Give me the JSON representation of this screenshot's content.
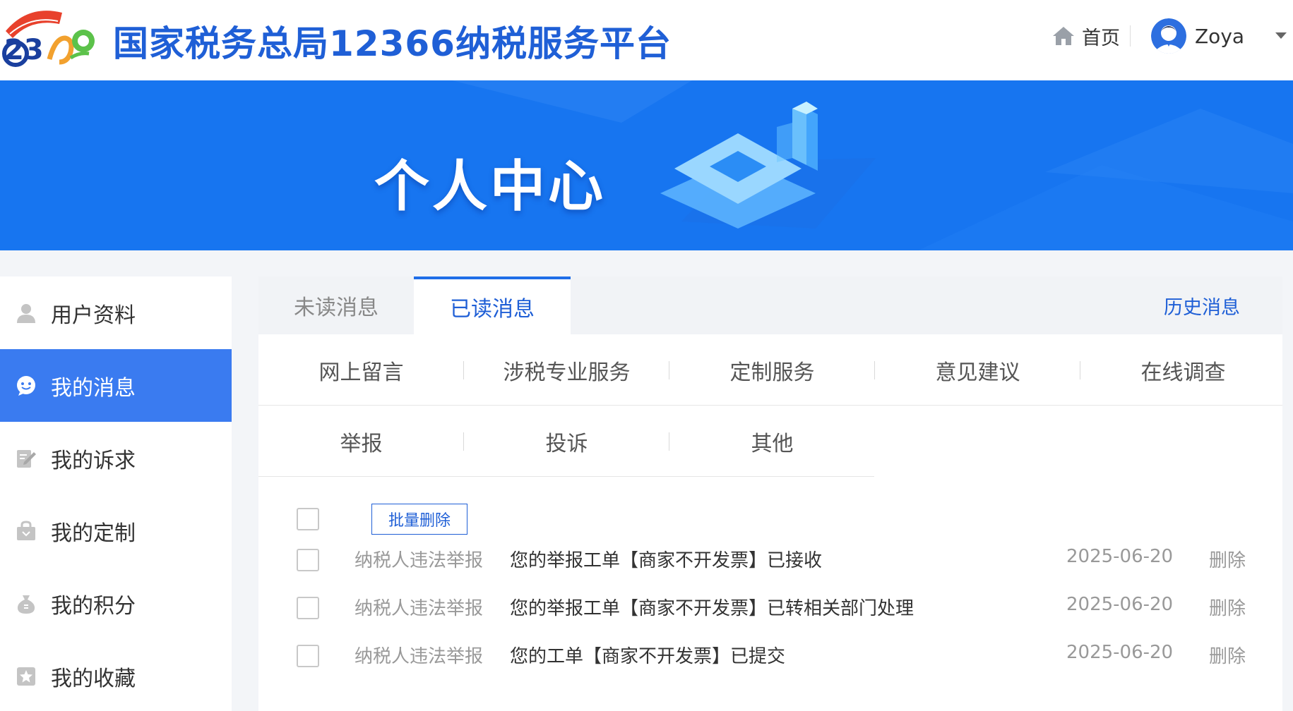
{
  "header": {
    "site_title": "国家税务总局12366纳税服务平台",
    "home_label": "首页",
    "user_name": "Zoya",
    "colors": {
      "brand_blue": "#1f5fd6",
      "banner_blue": "#1775f0"
    }
  },
  "banner": {
    "title": "个人中心"
  },
  "sidebar": {
    "items": [
      {
        "label": "用户资料",
        "icon": "user-icon"
      },
      {
        "label": "我的消息",
        "icon": "message-icon",
        "active": true
      },
      {
        "label": "我的诉求",
        "icon": "edit-icon"
      },
      {
        "label": "我的定制",
        "icon": "bag-icon"
      },
      {
        "label": "我的积分",
        "icon": "money-bag-icon"
      },
      {
        "label": "我的收藏",
        "icon": "star-icon"
      }
    ]
  },
  "tabs": {
    "unread_label": "未读消息",
    "read_label": "已读消息",
    "history_label": "历史消息"
  },
  "categories": {
    "row1": [
      "网上留言",
      "涉税专业服务",
      "定制服务",
      "意见建议",
      "在线调查"
    ],
    "row2": [
      "举报",
      "投诉",
      "其他"
    ]
  },
  "toolbar": {
    "batch_delete_label": "批量删除"
  },
  "messages": [
    {
      "category": "纳税人违法举报",
      "text": "您的举报工单【商家不开发票】已接收",
      "date": "2025-06-20",
      "action": "删除"
    },
    {
      "category": "纳税人违法举报",
      "text": "您的举报工单【商家不开发票】已转相关部门处理",
      "date": "2025-06-20",
      "action": "删除"
    },
    {
      "category": "纳税人违法举报",
      "text": "您的工单【商家不开发票】已提交",
      "date": "2025-06-20",
      "action": "删除"
    }
  ]
}
